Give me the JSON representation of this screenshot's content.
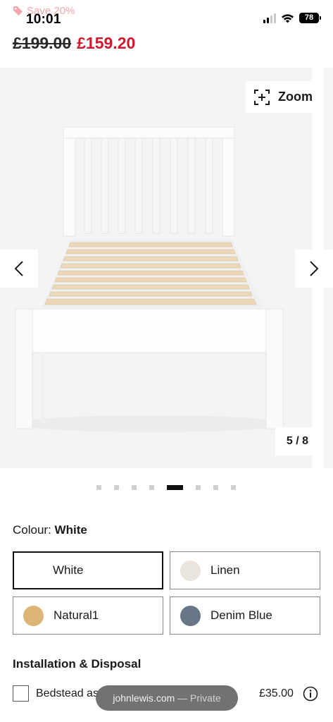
{
  "status_bar": {
    "time": "10:01",
    "battery": "78",
    "signal_bars_active": 2,
    "signal_bars_total": 4,
    "icons": [
      "signal-icon",
      "wifi-icon",
      "battery-icon"
    ]
  },
  "promo": {
    "save_text": "Save 20%",
    "icon": "tag-icon",
    "color": "#f2a7ac"
  },
  "price": {
    "original": "£199.00",
    "sale": "£159.20",
    "sale_color": "#d2182f"
  },
  "gallery": {
    "zoom_label": "Zoom",
    "zoom_icon": "zoom-in-icon",
    "counter": "5 / 8",
    "current": 5,
    "total": 8,
    "image_subject": "white wooden single bed frame with pine slats",
    "prev_icon": "chevron-left-icon",
    "next_icon": "chevron-right-icon"
  },
  "colour": {
    "label": "Colour:",
    "selected": "White",
    "options": [
      {
        "name": "White",
        "swatch": null
      },
      {
        "name": "Linen",
        "swatch": "#e9e5dd"
      },
      {
        "name": "Natural1",
        "swatch": "#ddb677"
      },
      {
        "name": "Denim Blue",
        "swatch": "#687786"
      }
    ]
  },
  "installation": {
    "title": "Installation & Disposal",
    "option_text": "Bedstead as",
    "option_price": "£35.00",
    "checked": false,
    "info_icon": "info-icon"
  },
  "browser": {
    "domain": "johnlewis.com",
    "mode": " — Private"
  }
}
